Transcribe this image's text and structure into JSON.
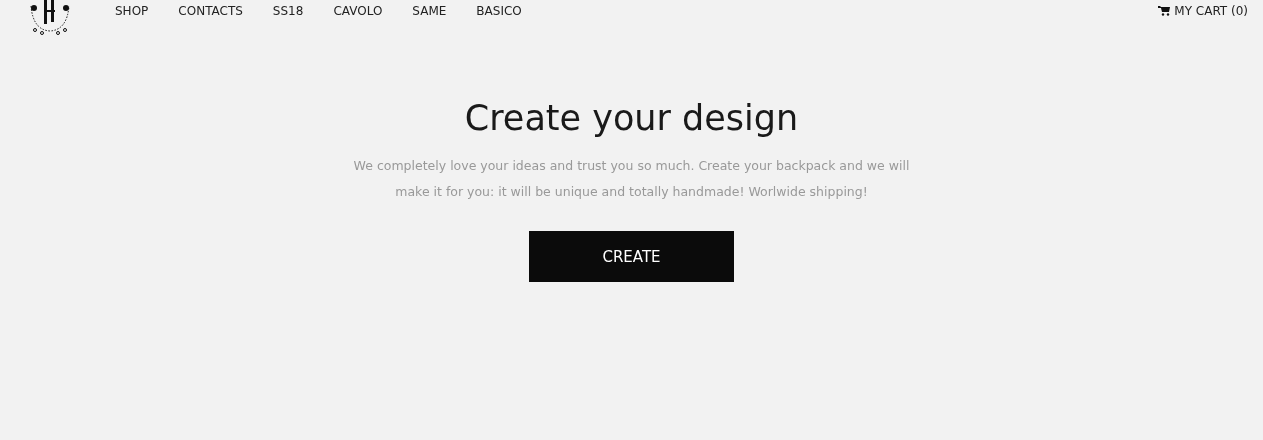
{
  "nav": {
    "items": [
      {
        "label": "SHOP"
      },
      {
        "label": "CONTACTS"
      },
      {
        "label": "SS18"
      },
      {
        "label": "CAVOLO"
      },
      {
        "label": "SAME"
      },
      {
        "label": "BASICO"
      }
    ],
    "cart": "MY CART (0)"
  },
  "hero": {
    "title": "Create your design",
    "text": "We completely love your ideas and trust you so much. Create your backpack and we will make it for you: it will be unique and totally handmade! Worlwide shipping!",
    "button": "CREATE"
  }
}
